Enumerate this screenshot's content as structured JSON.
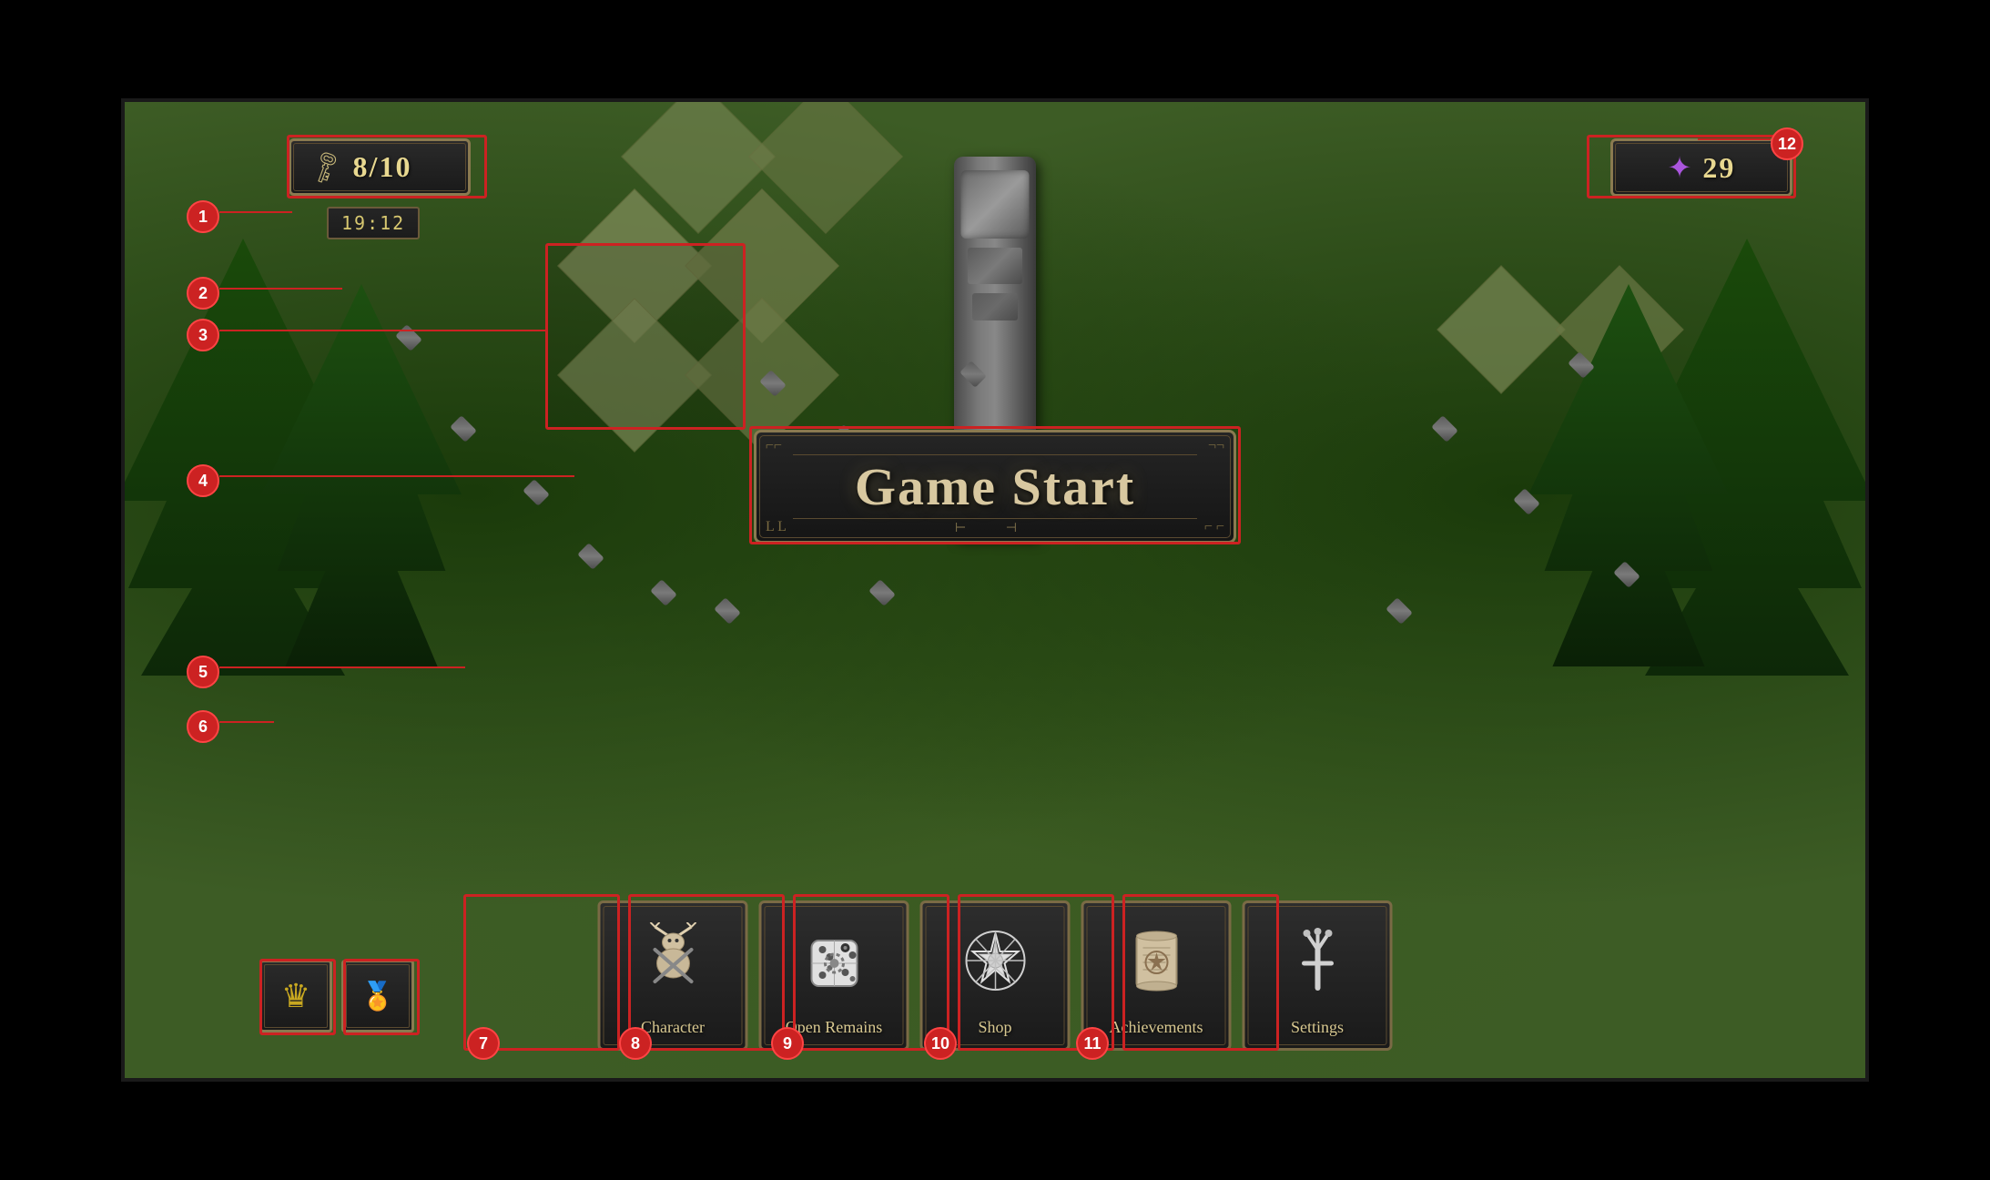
{
  "game": {
    "title": "Game Start",
    "bg_color": "#3d5c25"
  },
  "hud": {
    "keys": {
      "current": 8,
      "max": 10,
      "display": "8/10",
      "icon": "🗝"
    },
    "timer": {
      "value": "19:12"
    },
    "gems": {
      "value": 29,
      "display": "29",
      "icon": "✦"
    }
  },
  "buttons": {
    "game_start": "Game Start",
    "character": "Character",
    "open_remains": "Open Remains",
    "shop": "Shop",
    "achievements": "Achievements",
    "settings": "Settings"
  },
  "annotations": [
    {
      "id": 1,
      "label": "1"
    },
    {
      "id": 2,
      "label": "2"
    },
    {
      "id": 3,
      "label": "3"
    },
    {
      "id": 4,
      "label": "4"
    },
    {
      "id": 5,
      "label": "5"
    },
    {
      "id": 6,
      "label": "6"
    },
    {
      "id": 7,
      "label": "7"
    },
    {
      "id": 8,
      "label": "8"
    },
    {
      "id": 9,
      "label": "9"
    },
    {
      "id": 10,
      "label": "10"
    },
    {
      "id": 11,
      "label": "11"
    },
    {
      "id": 12,
      "label": "12"
    }
  ],
  "menu_icons": {
    "character": "⚔",
    "open_remains": "⚄",
    "shop": "✦",
    "achievements": "📜",
    "settings": "🔧"
  },
  "rank_icons": {
    "crown": "♛",
    "medal": "🏅"
  }
}
